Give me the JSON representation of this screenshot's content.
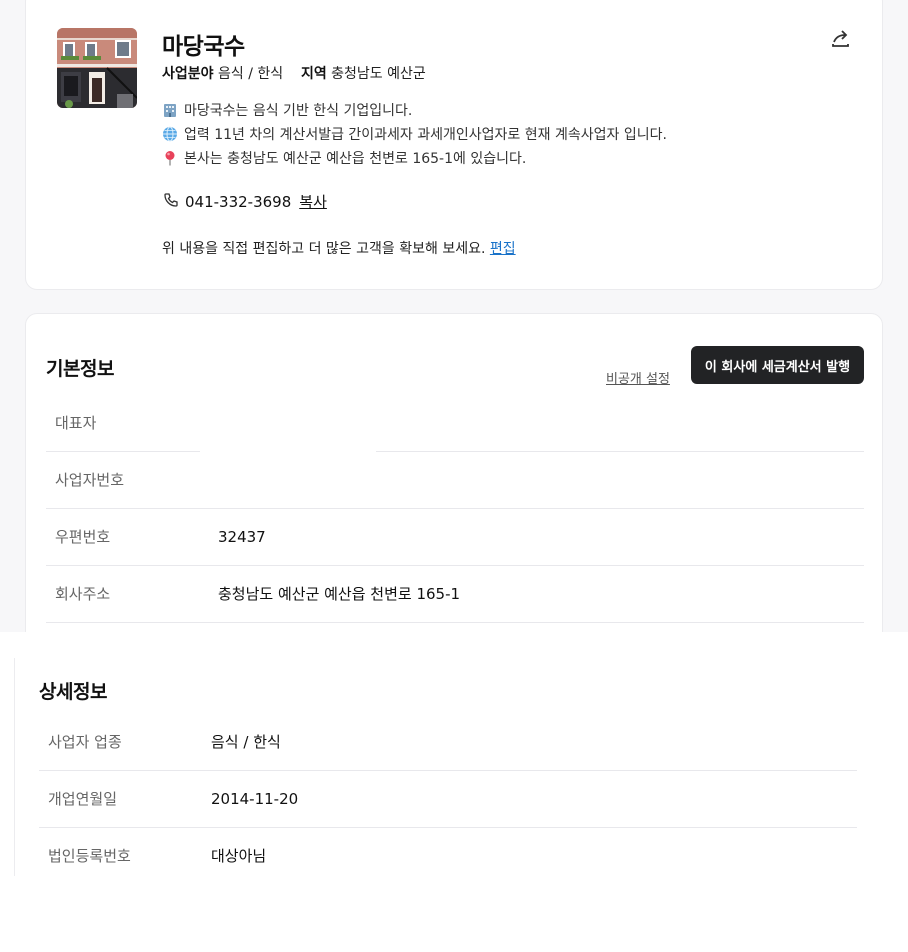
{
  "company": {
    "name": "마당국수",
    "field_label": "사업분야",
    "field_value": "음식 / 한식",
    "region_label": "지역",
    "region_value": "충청남도 예산군",
    "descriptions": [
      "마당국수는 음식 기반 한식 기업입니다.",
      "업력 11년 차의 계산서발급 간이과세자 과세개인사업자로 현재 계속사업자 입니다.",
      "본사는 충청남도 예산군 예산읍 천변로 165-1에 있습니다."
    ],
    "phone": "041-332-3698",
    "copy_label": "복사",
    "edit_prompt": "위 내용을 직접 편집하고 더 많은 고객을 확보해 보세요.",
    "edit_label": "편집"
  },
  "basic_info": {
    "title": "기본정보",
    "private_setting_label": "비공개 설정",
    "issue_button_label": "이 회사에 세금계산서 발행",
    "rows": [
      {
        "label": "대표자",
        "value": ""
      },
      {
        "label": "사업자번호",
        "value": ""
      },
      {
        "label": "우편번호",
        "value": "32437"
      },
      {
        "label": "회사주소",
        "value": "충청남도 예산군 예산읍 천변로 165-1"
      }
    ]
  },
  "detail_info": {
    "title": "상세정보",
    "rows": [
      {
        "label": "사업자 업종",
        "value": "음식 / 한식"
      },
      {
        "label": "개업연월일",
        "value": "2014-11-20"
      },
      {
        "label": "법인등록번호",
        "value": "대상아님"
      }
    ]
  },
  "icons": {
    "share": "share-icon",
    "building": "building-icon",
    "globe": "globe-icon",
    "pin": "map-pin-icon",
    "phone": "phone-icon"
  }
}
